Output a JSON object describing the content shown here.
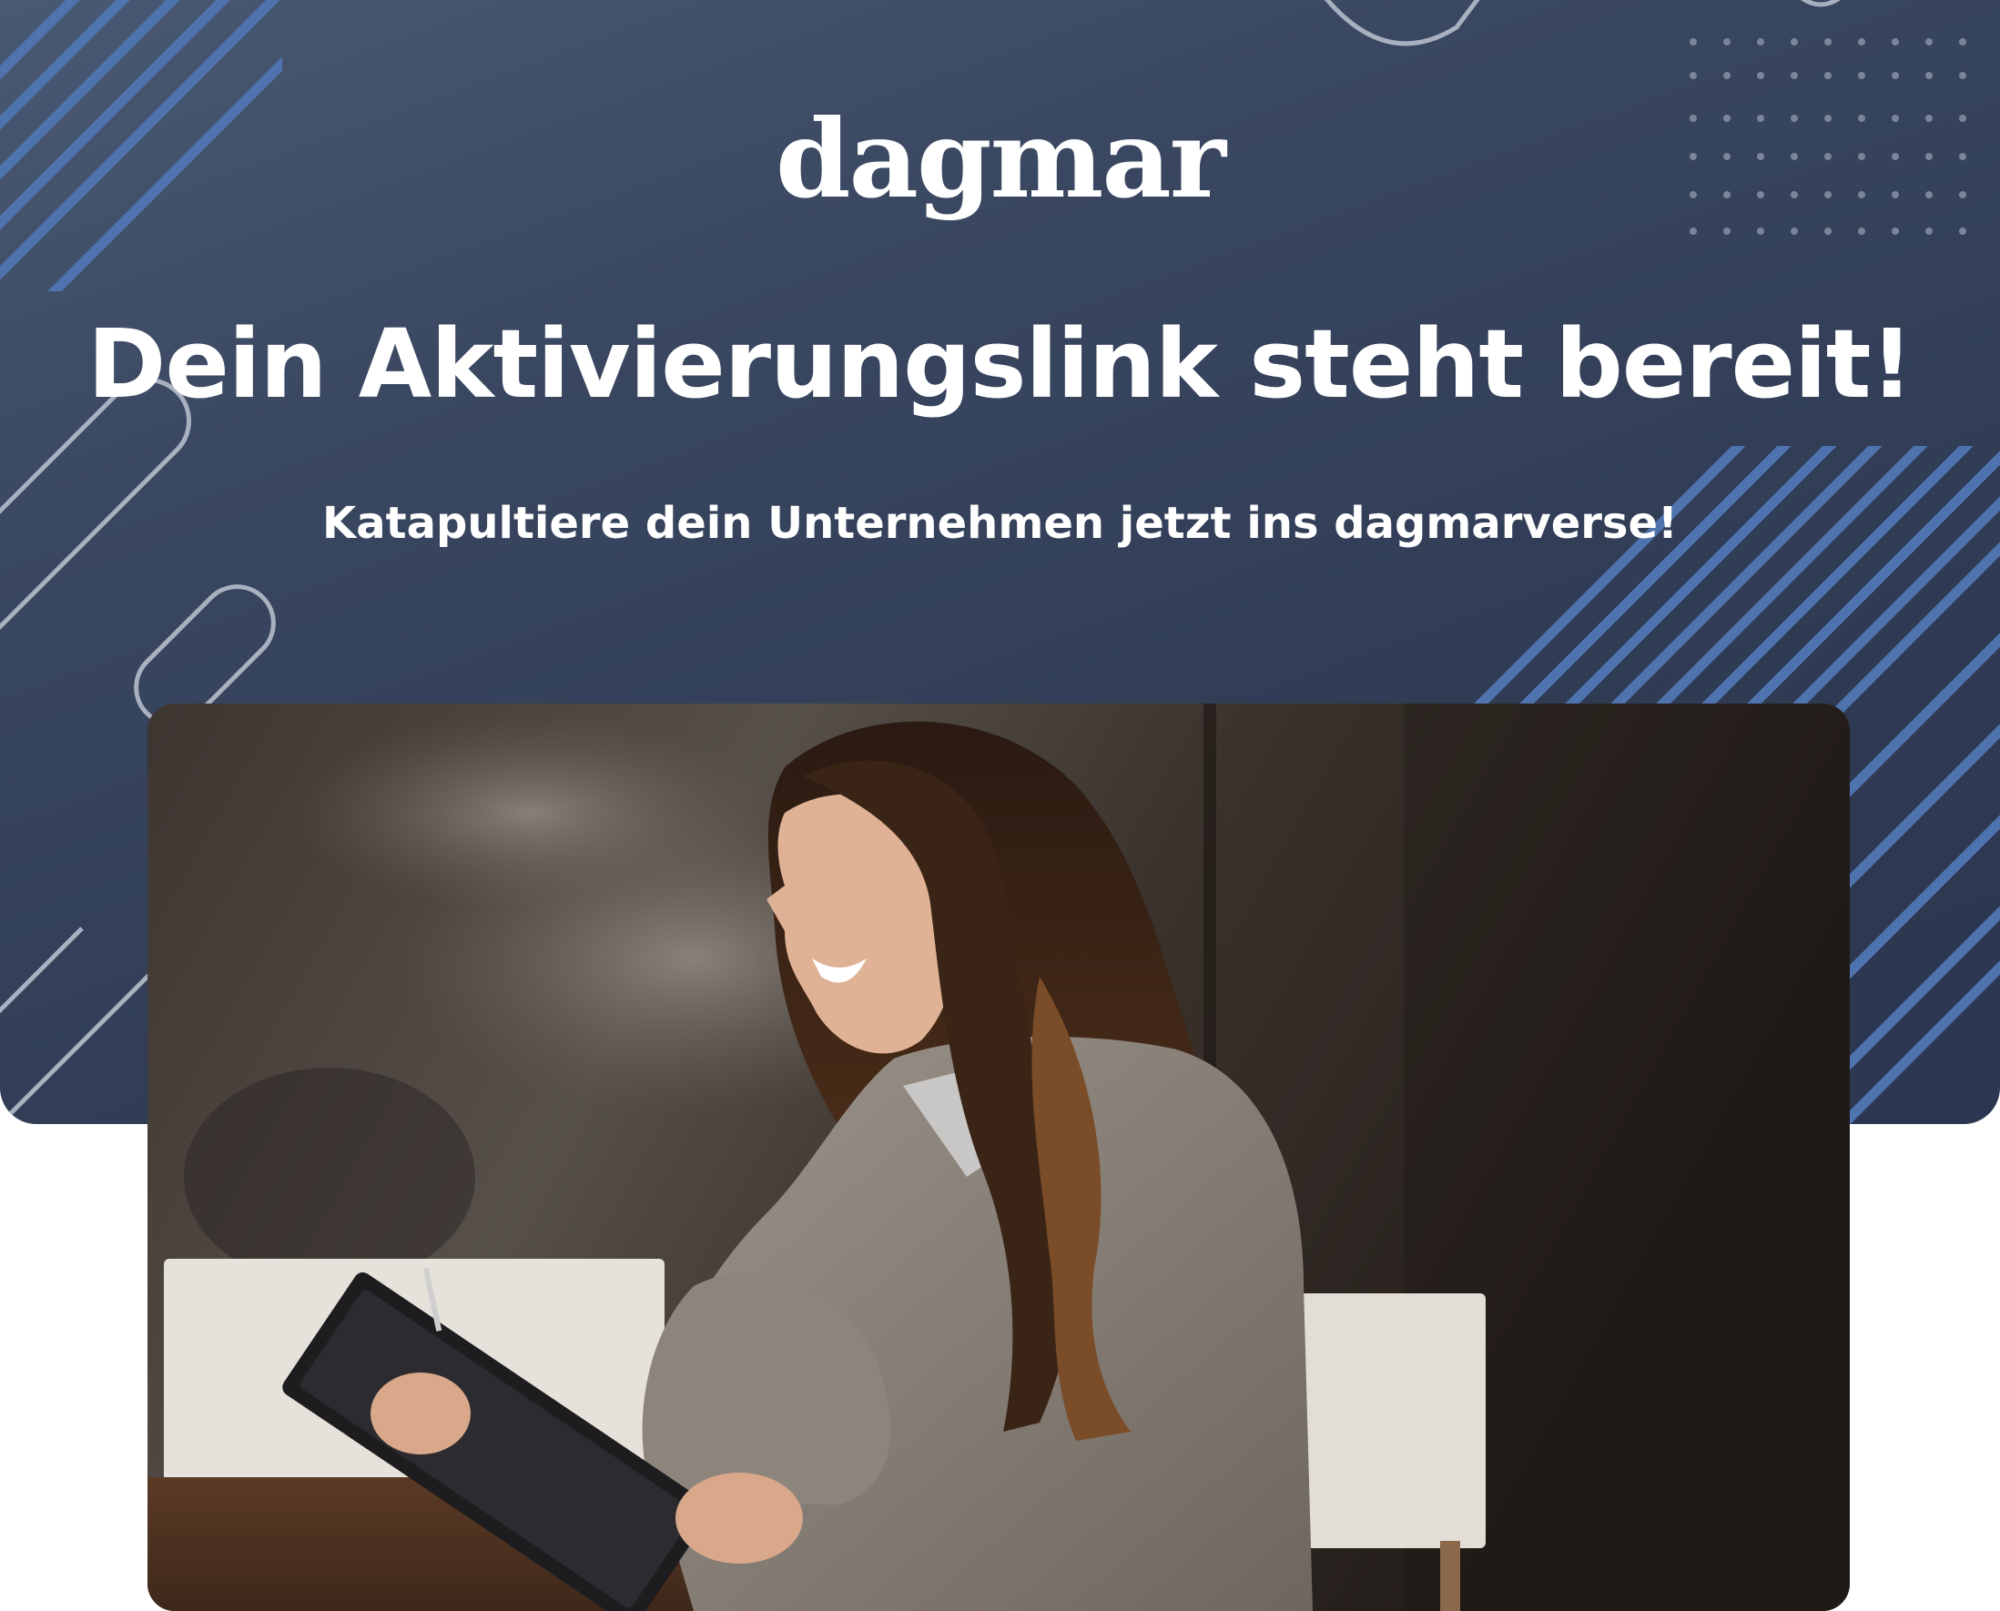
{
  "brand": {
    "logo_text": "dagmar"
  },
  "hero": {
    "headline": "Dein Aktivierungslink steht bereit!",
    "subline": "Katapultiere dein Unternehmen jetzt ins dagmarverse!"
  },
  "colors": {
    "banner_background": "#2f3b53",
    "stripe_accent": "#4f73ae",
    "outline_shapes": "#a9b0bf",
    "text": "#ffffff"
  },
  "image": {
    "subject": "woman-laughing-with-tablet-photo"
  }
}
